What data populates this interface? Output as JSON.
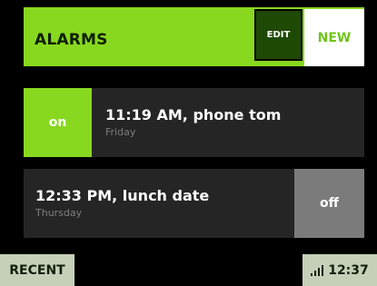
{
  "header": {
    "title": "ALARMS",
    "edit_label": "EDIT",
    "new_label": "NEW"
  },
  "alarms": [
    {
      "title": "11:19 AM, phone tom",
      "day": "Friday",
      "state": "on"
    },
    {
      "title": "12:33 PM, lunch date",
      "day": "Thursday",
      "state": "off"
    }
  ],
  "footer": {
    "recent_label": "RECENT",
    "clock": "12:37",
    "signal_icon": "signal-bars-icon"
  },
  "colors": {
    "accent": "#88d820",
    "panel": "#252525",
    "off_toggle": "#7b7b7b",
    "footer": "#c6d0b8"
  }
}
